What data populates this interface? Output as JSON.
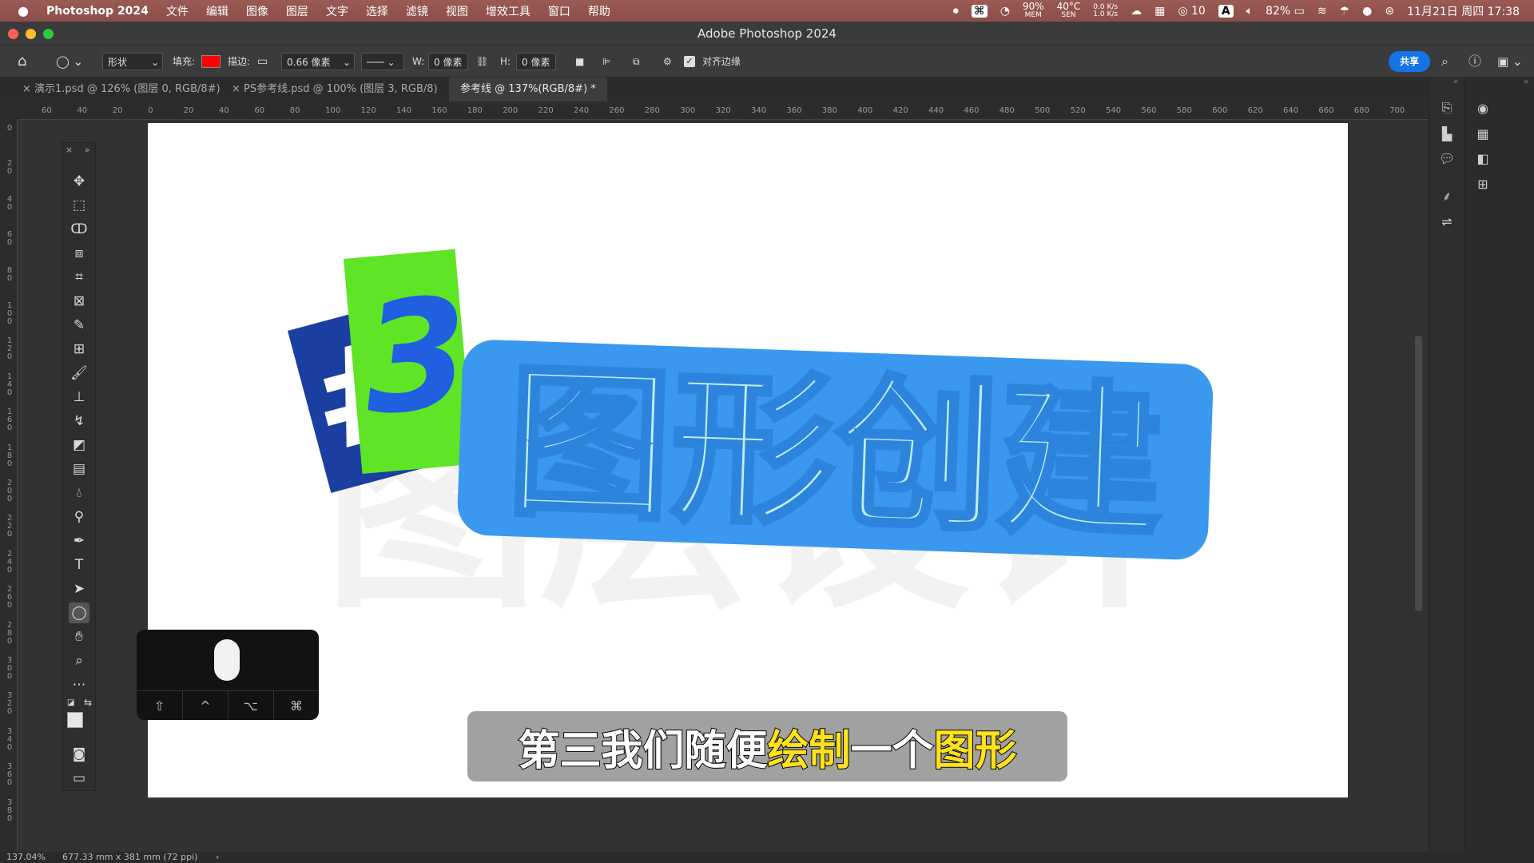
{
  "menubar": {
    "app_name": "Photoshop 2024",
    "items": [
      "文件",
      "编辑",
      "图像",
      "图层",
      "文字",
      "选择",
      "滤镜",
      "视图",
      "增效工具",
      "窗口",
      "帮助"
    ],
    "mem_pct": "90%",
    "mem_label": "MEM",
    "temp": "40°C",
    "temp_label": "SEN",
    "net_up": "0.0 K/s",
    "net_down": "1.0 K/s",
    "wechat_count": "10",
    "input_method": "A",
    "battery": "82%",
    "datetime": "11月21日 周四  17:38"
  },
  "window": {
    "title": "Adobe Photoshop 2024"
  },
  "options": {
    "mode": "形状",
    "fill_label": "填充:",
    "fill_color": "#ff0000",
    "stroke_label": "描边:",
    "stroke_width": "0.66 像素",
    "w_label": "W:",
    "w_value": "0 像素",
    "h_label": "H:",
    "h_value": "0 像素",
    "align_edges": "对齐边缘",
    "share": "共享"
  },
  "tabs": [
    {
      "label": "演示1.psd @ 126% (图层 0, RGB/8#)"
    },
    {
      "label": "PS参考线.psd @ 100% (图层 3, RGB/8)"
    },
    {
      "label": "参考线 @ 137%(RGB/8#) *"
    }
  ],
  "ruler_h": [
    "60",
    "40",
    "20",
    "0",
    "20",
    "40",
    "60",
    "80",
    "100",
    "120",
    "140",
    "160",
    "180",
    "200",
    "220",
    "240",
    "260",
    "280",
    "300",
    "320",
    "340",
    "360",
    "380",
    "400",
    "420",
    "440",
    "460",
    "480",
    "500",
    "520",
    "540",
    "560",
    "580",
    "600",
    "620",
    "640",
    "660",
    "680",
    "700"
  ],
  "ruler_v": [
    "0",
    "2 0",
    "4 0",
    "6 0",
    "8 0",
    "1 0 0",
    "1 2 0",
    "1 4 0",
    "1 6 0",
    "1 8 0",
    "2 0 0",
    "2 2 0",
    "2 4 0",
    "2 6 0",
    "2 8 0",
    "3 0 0",
    "3 2 0",
    "3 4 0",
    "3 6 0",
    "3 8 0"
  ],
  "artwork": {
    "hash": "#",
    "number": "3",
    "title": "图形创建",
    "watermark": "图层设计"
  },
  "subtitle": {
    "part1": "第三我们随便",
    "hl1": "绘制",
    "part2": "一个",
    "hl2": "图形"
  },
  "status": {
    "zoom": "137.04%",
    "doc_size": "677.33 mm x 381 mm (72 ppi)"
  },
  "keys": [
    "⇧",
    "^",
    "⌥",
    "⌘"
  ],
  "colors": {
    "accent": "#1f6fe0",
    "share_btn": "#1473e6",
    "title_fill": "#bfeefb",
    "title_stroke": "#3a98ee",
    "blue_block": "#1a3fa0",
    "green_block": "#5fe426"
  }
}
